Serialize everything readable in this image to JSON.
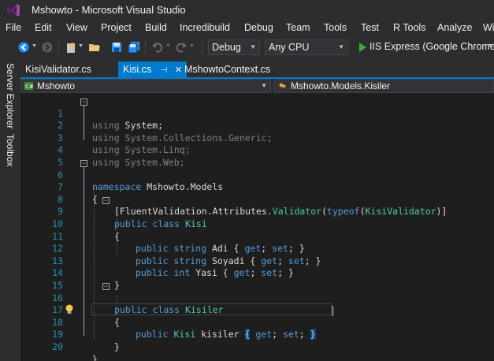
{
  "window": {
    "title": "Mshowto - Microsoft Visual Studio"
  },
  "menu": [
    "File",
    "Edit",
    "View",
    "Project",
    "Build",
    "Incredibuild",
    "Debug",
    "Team",
    "Tools",
    "Test",
    "R Tools",
    "Analyze",
    "Wi"
  ],
  "toolbar": {
    "configuration": "Debug",
    "platform": "Any CPU",
    "run_target": "IIS Express (Google Chrome)"
  },
  "side_tabs": [
    "Server Explorer",
    "Toolbox"
  ],
  "tabs": [
    {
      "label": "KisiValidator.cs",
      "active": false
    },
    {
      "label": "Kisi.cs",
      "active": true
    },
    {
      "label": "MshowtoContext.cs",
      "active": false
    }
  ],
  "navbar": {
    "project": "Mshowto",
    "type": "Mshowto.Models.Kisiler"
  },
  "code": {
    "l1": [
      "using",
      " System;"
    ],
    "l2": [
      "using",
      " System.Collections.Generic;"
    ],
    "l3": [
      "using",
      " System.Linq;"
    ],
    "l4": [
      "using",
      " System.Web;"
    ],
    "l6": [
      "namespace",
      " Mshowto.Models"
    ],
    "l7": "{",
    "l8": [
      "[FluentValidation.Attributes.",
      "Validator",
      "(",
      "typeof",
      "(",
      "KisiValidator",
      ")]"
    ],
    "l9": [
      "public",
      " ",
      "class",
      " ",
      "Kisi"
    ],
    "l10": "{",
    "l11": [
      "public",
      " ",
      "string",
      " Adi { ",
      "get",
      "; ",
      "set",
      "; }"
    ],
    "l12": [
      "public",
      " ",
      "string",
      " Soyadi { ",
      "get",
      "; ",
      "set",
      "; }"
    ],
    "l13": [
      "public",
      " ",
      "int",
      " Yasi { ",
      "get",
      "; ",
      "set",
      "; }"
    ],
    "l14": "}",
    "l16": [
      "public",
      " ",
      "class",
      " ",
      "Kisiler"
    ],
    "l17": "{",
    "l18": [
      "public",
      " ",
      "Kisi",
      " kisiler ",
      "{",
      " ",
      "get",
      "; ",
      "set",
      "; ",
      "}"
    ],
    "l19": "}",
    "l20": "}"
  },
  "line_numbers": [
    "1",
    "2",
    "3",
    "4",
    "5",
    "6",
    "7",
    "8",
    "9",
    "10",
    "11",
    "12",
    "13",
    "14",
    "15",
    "16",
    "17",
    "18",
    "19",
    "20"
  ],
  "colors": {
    "accent": "#007acc",
    "keyword": "#569cd6",
    "type": "#4ec9b0",
    "line_number": "#2b91af"
  },
  "icons": [
    "vs-logo-icon",
    "back-icon",
    "forward-icon",
    "new-project-icon",
    "open-folder-icon",
    "save-icon",
    "save-all-icon",
    "undo-icon",
    "redo-icon",
    "play-icon",
    "csharp-icon",
    "class-icon",
    "lightbulb-icon"
  ]
}
